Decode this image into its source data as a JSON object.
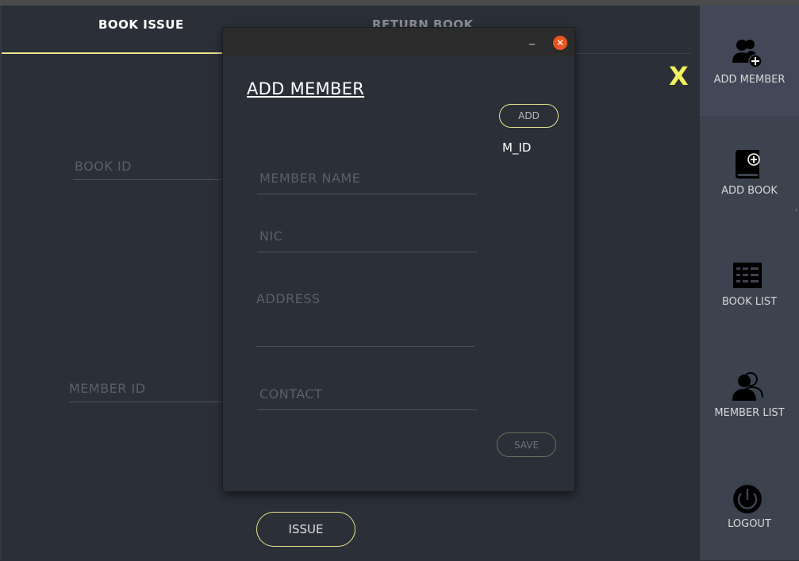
{
  "tabs": [
    {
      "label": "BOOK ISSUE"
    },
    {
      "label": "RETURN BOOK"
    }
  ],
  "issue_form": {
    "book_id_placeholder": "BOOK ID",
    "member_id_placeholder": "MEMBER ID",
    "issue_label": "ISSUE"
  },
  "close_label": "X",
  "sidebar": {
    "items": [
      {
        "label": "ADD MEMBER",
        "icon": "add-member-icon"
      },
      {
        "label": "ADD BOOK",
        "icon": "add-book-icon"
      },
      {
        "label": "BOOK LIST",
        "icon": "book-list-icon"
      },
      {
        "label": "MEMBER LIST",
        "icon": "member-list-icon"
      },
      {
        "label": "LOGOUT",
        "icon": "power-icon"
      }
    ]
  },
  "dialog": {
    "minimize_label": "_",
    "close_glyph": "✕",
    "title": "ADD MEMBER",
    "add_label": "ADD",
    "member_id_label": "M_ID",
    "fields": {
      "member_name": "MEMBER NAME",
      "nic": "NIC",
      "address": "ADDRESS",
      "contact": "CONTACT"
    },
    "save_label": "SAVE"
  },
  "colors": {
    "background": "#2b2f38",
    "sidebar": "#3d424f",
    "accent": "#e7e58a",
    "close_x": "#f3f05f",
    "window_close": "#e95420"
  }
}
